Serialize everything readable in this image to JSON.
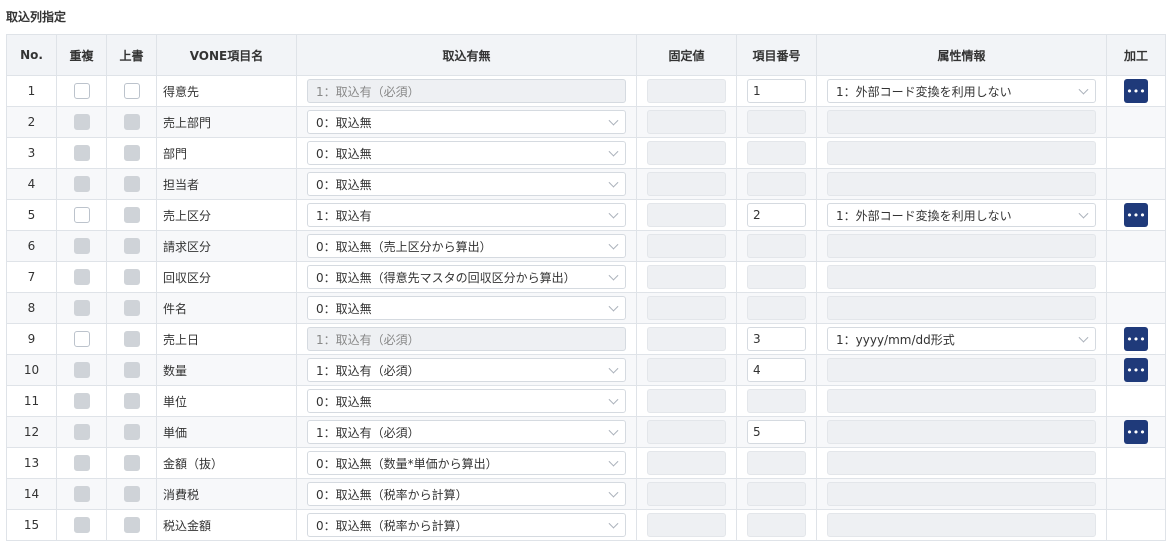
{
  "section_title": "取込列指定",
  "columns": {
    "no": "No.",
    "dup": "重複",
    "over": "上書",
    "name": "VONE項目名",
    "import": "取込有無",
    "fixed": "固定値",
    "num": "項目番号",
    "attr": "属性情報",
    "act": "加工"
  },
  "icons": {
    "select_arrow": "chevron-down-icon",
    "action": "more-icon"
  },
  "colors": {
    "action_button": "#1f3a7a",
    "header_bg": "#f2f4f7",
    "disabled_bg": "#eef0f3"
  },
  "rows": [
    {
      "no": "1",
      "name": "得意先",
      "import": "1：取込有（必須）",
      "import_disabled": true,
      "dup_enabled": true,
      "over_enabled": true,
      "num": "1",
      "attr": "1：外部コード変換を利用しない",
      "has_action": true
    },
    {
      "no": "2",
      "name": "売上部門",
      "import": "0：取込無",
      "import_disabled": false,
      "dup_enabled": false,
      "over_enabled": false,
      "num": "",
      "attr": "",
      "has_action": false
    },
    {
      "no": "3",
      "name": "部門",
      "import": "0：取込無",
      "import_disabled": false,
      "dup_enabled": false,
      "over_enabled": false,
      "num": "",
      "attr": "",
      "has_action": false
    },
    {
      "no": "4",
      "name": "担当者",
      "import": "0：取込無",
      "import_disabled": false,
      "dup_enabled": false,
      "over_enabled": false,
      "num": "",
      "attr": "",
      "has_action": false
    },
    {
      "no": "5",
      "name": "売上区分",
      "import": "1：取込有",
      "import_disabled": false,
      "dup_enabled": true,
      "over_enabled": false,
      "num": "2",
      "attr": "1：外部コード変換を利用しない",
      "has_action": true
    },
    {
      "no": "6",
      "name": "請求区分",
      "import": "0：取込無（売上区分から算出）",
      "import_disabled": false,
      "dup_enabled": false,
      "over_enabled": false,
      "num": "",
      "attr": "",
      "has_action": false
    },
    {
      "no": "7",
      "name": "回収区分",
      "import": "0：取込無（得意先マスタの回収区分から算出）",
      "import_disabled": false,
      "dup_enabled": false,
      "over_enabled": false,
      "num": "",
      "attr": "",
      "has_action": false
    },
    {
      "no": "8",
      "name": "件名",
      "import": "0：取込無",
      "import_disabled": false,
      "dup_enabled": false,
      "over_enabled": false,
      "num": "",
      "attr": "",
      "has_action": false
    },
    {
      "no": "9",
      "name": "売上日",
      "import": "1：取込有（必須）",
      "import_disabled": true,
      "dup_enabled": true,
      "over_enabled": false,
      "num": "3",
      "attr": "1：yyyy/mm/dd形式",
      "has_action": true
    },
    {
      "no": "10",
      "name": "数量",
      "import": "1：取込有（必須）",
      "import_disabled": false,
      "dup_enabled": false,
      "over_enabled": false,
      "num": "4",
      "attr": "",
      "has_action": true
    },
    {
      "no": "11",
      "name": "単位",
      "import": "0：取込無",
      "import_disabled": false,
      "dup_enabled": false,
      "over_enabled": false,
      "num": "",
      "attr": "",
      "has_action": false
    },
    {
      "no": "12",
      "name": "単価",
      "import": "1：取込有（必須）",
      "import_disabled": false,
      "dup_enabled": false,
      "over_enabled": false,
      "num": "5",
      "attr": "",
      "has_action": true
    },
    {
      "no": "13",
      "name": "金額（抜）",
      "import": "0：取込無（数量*単価から算出）",
      "import_disabled": false,
      "dup_enabled": false,
      "over_enabled": false,
      "num": "",
      "attr": "",
      "has_action": false
    },
    {
      "no": "14",
      "name": "消費税",
      "import": "0：取込無（税率から計算）",
      "import_disabled": false,
      "dup_enabled": false,
      "over_enabled": false,
      "num": "",
      "attr": "",
      "has_action": false
    },
    {
      "no": "15",
      "name": "税込金額",
      "import": "0：取込無（税率から計算）",
      "import_disabled": false,
      "dup_enabled": false,
      "over_enabled": false,
      "num": "",
      "attr": "",
      "has_action": false
    }
  ]
}
